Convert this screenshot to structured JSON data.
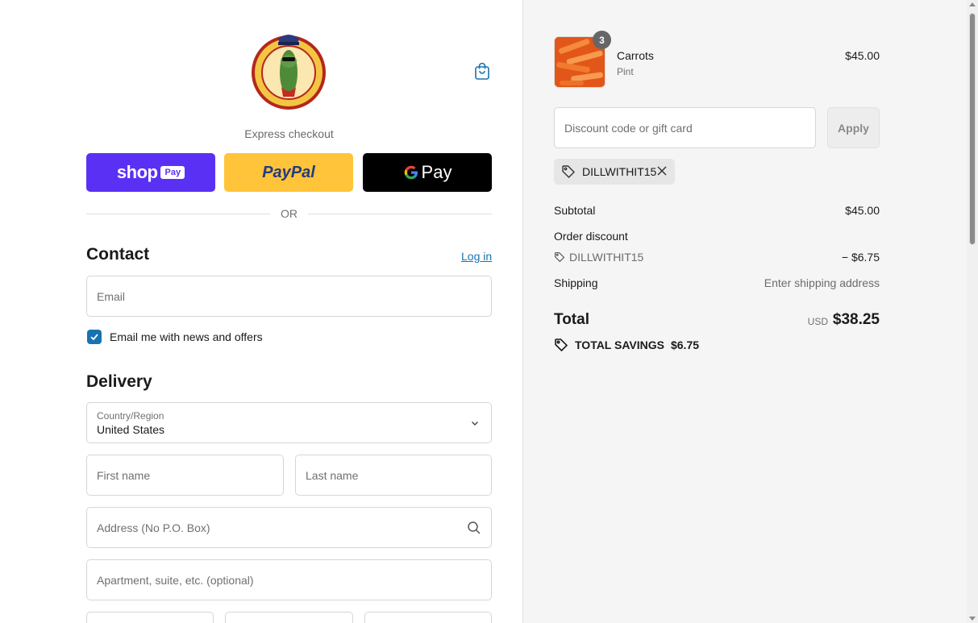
{
  "checkout": {
    "express_label": "Express checkout",
    "payment_buttons": {
      "shop_pay": "shop",
      "shop_pay_badge": "Pay",
      "paypal": "PayPal",
      "gpay": "Pay"
    },
    "or_label": "OR",
    "contact": {
      "title": "Contact",
      "login_link": "Log in",
      "email_placeholder": "Email",
      "newsletter_label": "Email me with news and offers",
      "newsletter_checked": true
    },
    "delivery": {
      "title": "Delivery",
      "country_label": "Country/Region",
      "country_value": "United States",
      "first_name_placeholder": "First name",
      "last_name_placeholder": "Last name",
      "address_placeholder": "Address (No P.O. Box)",
      "apartment_placeholder": "Apartment, suite, etc. (optional)"
    }
  },
  "summary": {
    "item": {
      "name": "Carrots",
      "variant": "Pint",
      "price": "$45.00",
      "quantity": "3"
    },
    "discount_placeholder": "Discount code or gift card",
    "apply_label": "Apply",
    "applied_code": "DILLWITHIT15",
    "subtotal_label": "Subtotal",
    "subtotal_value": "$45.00",
    "order_discount_label": "Order discount",
    "discount_code": "DILLWITHIT15",
    "discount_value": "− $6.75",
    "shipping_label": "Shipping",
    "shipping_value": "Enter shipping address",
    "total_label": "Total",
    "currency": "USD",
    "total_value": "$38.25",
    "savings_label": "TOTAL SAVINGS",
    "savings_value": "$6.75"
  },
  "colors": {
    "accent": "#1773b0",
    "shop_pay": "#5a31f4",
    "paypal": "#ffc439",
    "gpay": "#000000"
  }
}
